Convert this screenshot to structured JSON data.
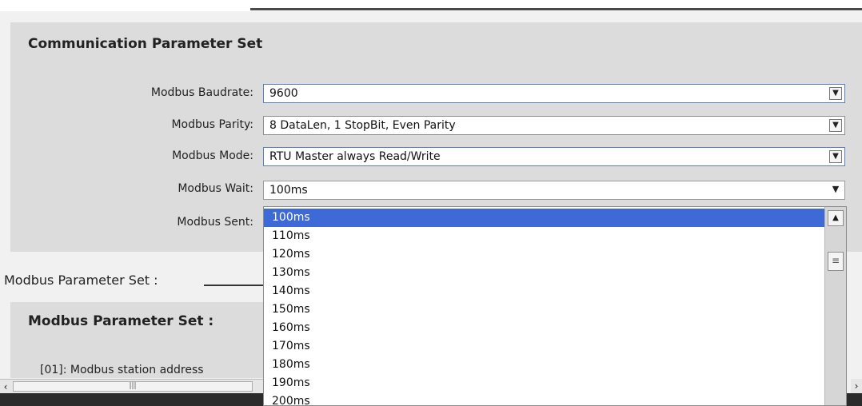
{
  "comm_panel": {
    "title": "Communication Parameter Set",
    "fields": [
      {
        "label": "Modbus Baudrate:",
        "value": "9600"
      },
      {
        "label": "Modbus Parity:",
        "value": "8 DataLen, 1 StopBit, Even Parity"
      },
      {
        "label": "Modbus Mode:",
        "value": "RTU Master always Read/Write"
      },
      {
        "label": "Modbus Wait:",
        "value": "100ms"
      },
      {
        "label": "Modbus Sent:",
        "value": ""
      }
    ]
  },
  "modbus_section": {
    "label": "Modbus Parameter Set :",
    "panel_title": "Modbus Parameter Set :",
    "first_param": "[01]: Modbus  station address"
  },
  "dropdown": {
    "selected_index": 0,
    "options": [
      "100ms",
      "110ms",
      "120ms",
      "130ms",
      "140ms",
      "150ms",
      "160ms",
      "170ms",
      "180ms",
      "190ms",
      "200ms"
    ]
  },
  "icons": {
    "combo_arrow": "chevron-down-icon",
    "scroll_up": "chevron-up-icon",
    "scroll_thumb": "grip-icon",
    "scroll_left": "chevron-left-icon",
    "scroll_right": "chevron-right-icon"
  },
  "colors": {
    "selection": "#3d6ad6",
    "panel_background": "#dcdcdc"
  }
}
